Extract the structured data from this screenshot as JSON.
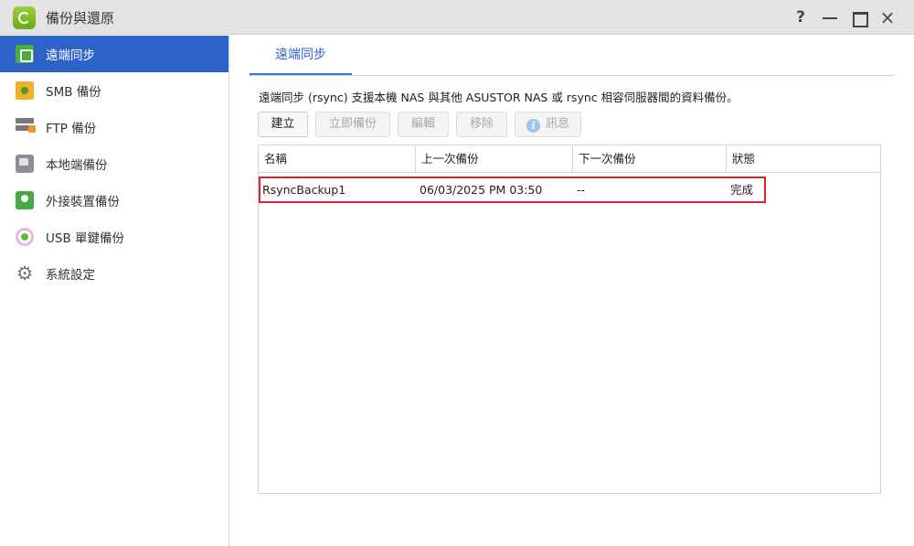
{
  "window": {
    "title": "備份與還原",
    "help_label": "?",
    "close_label": "×"
  },
  "sidebar": {
    "items": [
      {
        "label": "遠端同步",
        "icon": "rsync-icon",
        "active": true
      },
      {
        "label": "SMB 備份",
        "icon": "smb-backup-icon"
      },
      {
        "label": "FTP 備份",
        "icon": "ftp-backup-icon"
      },
      {
        "label": "本地端備份",
        "icon": "local-backup-icon"
      },
      {
        "label": "外接裝置備份",
        "icon": "external-device-icon"
      },
      {
        "label": "USB 單鍵備份",
        "icon": "usb-one-touch-icon"
      },
      {
        "label": "系統設定",
        "icon": "gear-icon"
      }
    ]
  },
  "main": {
    "tab_label": "遠端同步",
    "description": "遠端同步 (rsync) 支援本機 NAS 與其他 ASUSTOR NAS 或 rsync 相容伺服器間的資料備份。",
    "toolbar": {
      "create": "建立",
      "backup_now": "立即備份",
      "edit": "編輯",
      "remove": "移除",
      "info": "訊息",
      "info_icon_glyph": "i"
    },
    "table": {
      "columns": [
        "名稱",
        "上一次備份",
        "下一次備份",
        "狀態"
      ],
      "rows": [
        {
          "name": "RsyncBackup1",
          "last_backup": "06/03/2025 PM 03:50",
          "next_backup": "--",
          "status": "完成"
        }
      ]
    }
  },
  "colors": {
    "accent": "#2d63c8",
    "highlight_border": "#d9232d"
  }
}
